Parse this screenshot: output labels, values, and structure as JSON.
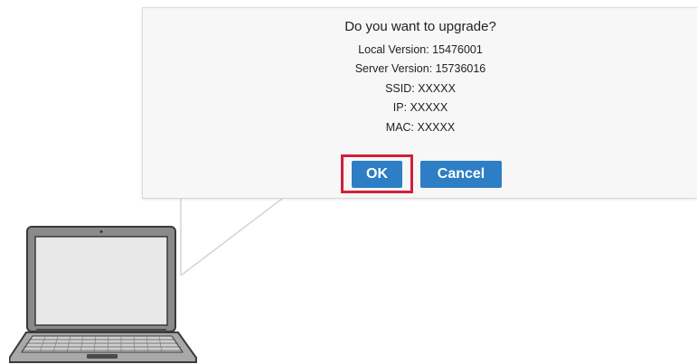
{
  "dialog": {
    "title": "Do you want to upgrade?",
    "local_version": "Local Version: 15476001",
    "server_version": "Server Version: 15736016",
    "ssid": "SSID: XXXXX",
    "ip": "IP: XXXXX",
    "mac": "MAC: XXXXX",
    "ok_label": "OK",
    "cancel_label": "Cancel"
  },
  "colors": {
    "button": "#2d7ec4",
    "highlight": "#d21f3c",
    "dialog_bg": "#f7f7f7"
  },
  "icons": [
    "laptop-icon"
  ]
}
